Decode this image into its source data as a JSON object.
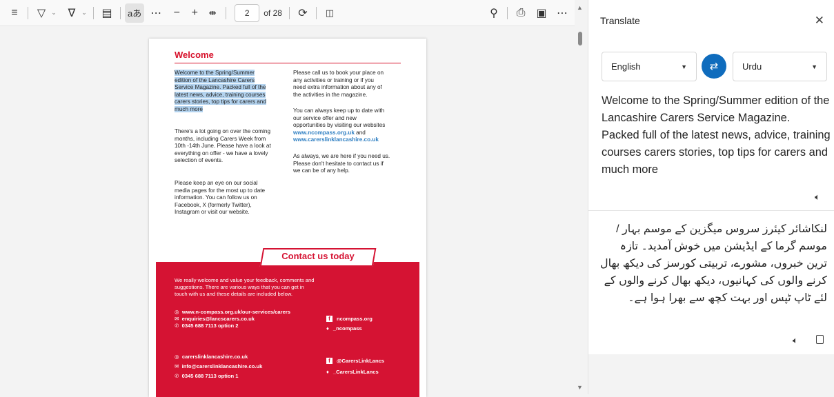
{
  "toolbar": {
    "page_number": "2",
    "page_count": "of 28",
    "read_aloud_label": "aあ"
  },
  "document": {
    "title": "Welcome",
    "col1_highlighted": [
      "Welcome to the Spring/Summer",
      "edition of the Lancashire Carers",
      "Service Magazine. Packed full of the",
      "latest news, advice, training courses",
      "carers stories, top tips for carers and",
      "much more"
    ],
    "col1_p2": [
      "There's a lot going on over the coming",
      "months, including Carers Week from",
      "10th -14th June. Please have a look at",
      "everything on offer - we have a lovely",
      "selection of events."
    ],
    "col1_p3": [
      "Please keep an eye on our social",
      "media pages for the most up to date",
      "information. You can follow us on",
      "Facebook, X (formerly Twitter),",
      "Instagram or visit our website."
    ],
    "col2_p1": [
      "Please call us to book your place  on",
      "any activities or training or if you",
      "need extra information about any of",
      "the activities in the magazine."
    ],
    "col2_p2": [
      "You can always keep up to date with",
      "our service offer and new",
      "opportunities by visiting our websites"
    ],
    "col2_link1": "www.ncompass.org.uk",
    "col2_and": "and",
    "col2_link2": "www.carerslinklancashire.co.uk",
    "col2_p3": [
      "As always, we are here if you need us.",
      "Please don't hesitate to contact us if",
      "we can be of any help."
    ],
    "contact_title": "Contact us today",
    "contact_intro": [
      "We really welcome and value your feedback, comments and",
      "suggestions. There are various ways that you can get in",
      "touch with us and these details are included below."
    ],
    "ncompass_web": "www.n-compass.org.uk/our-services/carers",
    "ncompass_email": "enquiries@lancscarers.co.uk",
    "ncompass_phone": "0345 688 7113 option 2",
    "ncompass_fb": "ncompass.org",
    "ncompass_tw": "_ncompass",
    "cll_web": "carerslinklancashire.co.uk",
    "cll_email": "info@carerslinklancashire.co.uk",
    "cll_phone": "0345 688 7113 option 1",
    "cll_fb": "@CarersLinkLancs",
    "cll_tw": "_CarersLinkLancs"
  },
  "panel": {
    "title": "Translate",
    "source_language": "English",
    "target_language": "Urdu",
    "source_text": "Welcome to the Spring/Summer edition of the Lancashire Carers Service Magazine. Packed full of the latest news, advice, training courses carers stories, top tips for carers and much more",
    "translated_text": "لنکاشائر کیئرز سروس میگزین کے موسم بہار / موسم گرما کے ایڈیشن میں خوش آمدید۔ تازہ ترین خبروں، مشورے، تربیتی کورسز کی دیکھ بھال کرنے والوں کی کہانیوں، دیکھ بھال کرنے والوں کے لئے ٹاپ ٹپس اور بہت کچھ سے بھرا ہوا ہے۔"
  },
  "colors": {
    "accent": "#0f6cbd",
    "brand_red": "#d51333",
    "highlight": "#b3d3ef"
  }
}
